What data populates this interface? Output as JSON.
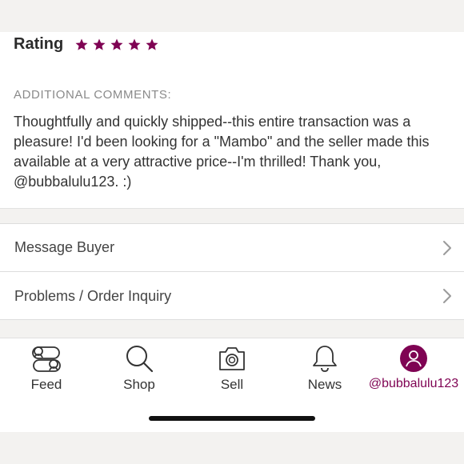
{
  "review": {
    "rating_label": "Rating",
    "stars": 5,
    "comments_heading": "ADDITIONAL COMMENTS:",
    "comments_text": "Thoughtfully and quickly shipped--this entire transaction was a pleasure! I'd been looking for a \"Mambo\" and the seller made this available at a very attractive price--I'm thrilled! Thank you, @bubbalulu123. :)"
  },
  "actions": [
    {
      "label": "Message Buyer",
      "icon": "chevron-right-icon"
    },
    {
      "label": "Problems / Order Inquiry",
      "icon": "chevron-right-icon"
    }
  ],
  "tabbar": {
    "tabs": [
      {
        "label": "Feed",
        "icon": "feed-icon"
      },
      {
        "label": "Shop",
        "icon": "search-icon"
      },
      {
        "label": "Sell",
        "icon": "camera-icon"
      },
      {
        "label": "News",
        "icon": "bell-icon"
      },
      {
        "label": "@bubbalulu123",
        "icon": "profile-icon",
        "active": true
      }
    ]
  },
  "colors": {
    "brand": "#7f0353",
    "text": "#2b2b2b",
    "muted": "#8a8a8a",
    "background": "#f3f2f0"
  }
}
